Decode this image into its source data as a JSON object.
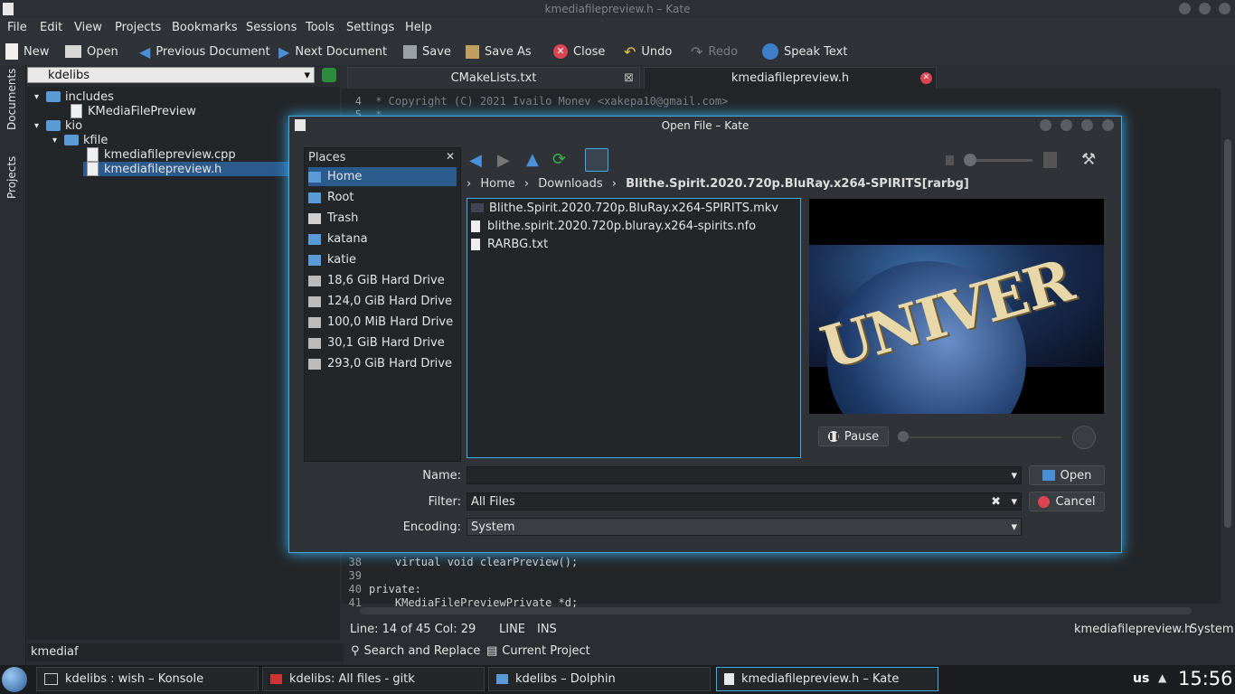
{
  "window": {
    "title": "kmediafilepreview.h – Kate"
  },
  "menu": [
    "File",
    "Edit",
    "View",
    "Projects",
    "Bookmarks",
    "Sessions",
    "Tools",
    "Settings",
    "Help"
  ],
  "toolbar": {
    "new": "New",
    "open": "Open",
    "previous": "Previous Document",
    "next": "Next Document",
    "save": "Save",
    "save_as": "Save As",
    "close": "Close",
    "undo": "Undo",
    "redo": "Redo",
    "speak": "Speak Text"
  },
  "side_tabs": {
    "documents": "Documents",
    "projects": "Projects"
  },
  "project": {
    "selector": "kdelibs",
    "tree": [
      "includes",
      "KMediaFilePreview",
      "kio",
      "kfile",
      "kmediafilepreview.cpp",
      "kmediafilepreview.h"
    ]
  },
  "tabs": [
    "CMakeLists.txt",
    "kmediafilepreview.h"
  ],
  "editor": {
    "lines": [
      {
        "n": "4",
        "text": " * Copyright (C) 2021 Ivailo Monev <xakepa10@gmail.com>"
      },
      {
        "n": "5",
        "text": " *"
      },
      {
        "n": "38",
        "text": "    virtual void clearPreview();"
      },
      {
        "n": "39",
        "text": ""
      },
      {
        "n": "40",
        "text": "private:"
      },
      {
        "n": "41",
        "text": "    KMediaFilePreviewPrivate *d;"
      }
    ]
  },
  "status": {
    "position": "Line: 14 of 45 Col: 29",
    "mode": "LINE",
    "ins": "INS",
    "filename": "kmediafilepreview.h",
    "encoding": "System"
  },
  "bottom": {
    "search": "Search and Replace",
    "project": "Current Project",
    "filter": "kmediaf"
  },
  "dialog": {
    "title": "Open File – Kate",
    "places_header": "Places",
    "places": [
      "Home",
      "Root",
      "Trash",
      "katana",
      "katie",
      "18,6 GiB Hard Drive",
      "124,0 GiB Hard Drive",
      "100,0 MiB Hard Drive",
      "30,1 GiB Hard Drive",
      "293,0 GiB Hard Drive"
    ],
    "breadcrumb": [
      "Home",
      "Downloads",
      "Blithe.Spirit.2020.720p.BluRay.x264-SPIRITS[rarbg]"
    ],
    "files": [
      "Blithe.Spirit.2020.720p.BluRay.x264-SPIRITS.mkv",
      "blithe.spirit.2020.720p.bluray.x264-spirits.nfo",
      "RARBG.txt"
    ],
    "preview_text": "UNIVER",
    "pause_label": "Pause",
    "name_label": "Name:",
    "name_value": "",
    "filter_label": "Filter:",
    "filter_value": "All Files",
    "encoding_label": "Encoding:",
    "encoding_value": "System",
    "open_label": "Open",
    "cancel_label": "Cancel"
  },
  "taskbar": {
    "tasks": [
      "kdelibs : wish – Konsole",
      "kdelibs: All files - gitk",
      "kdelibs – Dolphin",
      "kmediafilepreview.h – Kate"
    ],
    "layout": "us",
    "time": "15:56"
  },
  "colors": {
    "accent": "#3daee9",
    "background": "#2f3236",
    "view": "#232629",
    "selection": "#2b5a8c"
  }
}
